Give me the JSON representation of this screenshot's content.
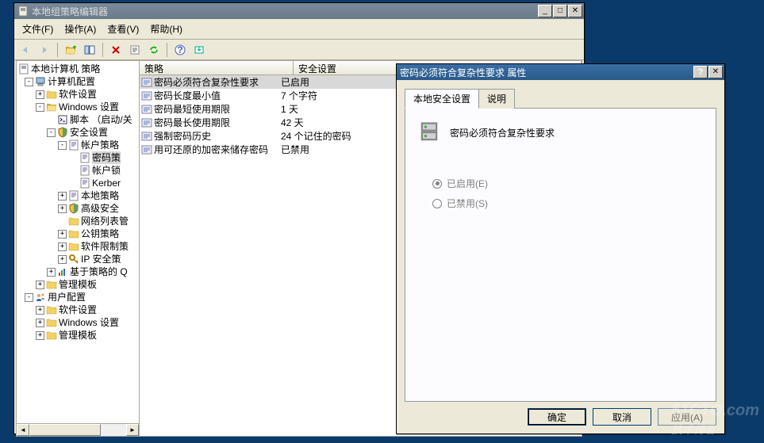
{
  "main_window": {
    "title": "本地组策略编辑器",
    "menu": {
      "file": "文件(F)",
      "action": "操作(A)",
      "view": "查看(V)",
      "help": "帮助(H)"
    }
  },
  "tree": {
    "root": "本地计算机 策略",
    "computer_config": "计算机配置",
    "software_settings": "软件设置",
    "windows_settings": "Windows 设置",
    "scripts": "脚本 （启动/关",
    "security_settings": "安全设置",
    "account_policies": "帐户策略",
    "password_policy": "密码策",
    "account_lockout": "帐户锁",
    "kerberos": "Kerber",
    "local_policies": "本地策略",
    "advanced_security": "高级安全",
    "network_list": "网络列表管",
    "public_key": "公钥策略",
    "software_restrict": "软件限制策",
    "ip_security": "IP 安全策",
    "policy_based_q": "基于策略的 Q",
    "admin_templates": "管理模板",
    "user_config": "用户配置",
    "software_settings2": "软件设置",
    "windows_settings2": "Windows 设置",
    "admin_templates2": "管理模板"
  },
  "list": {
    "col_policy": "策略",
    "col_setting": "安全设置",
    "rows": [
      {
        "name": "密码必须符合复杂性要求",
        "value": "已启用"
      },
      {
        "name": "密码长度最小值",
        "value": "7 个字符"
      },
      {
        "name": "密码最短使用期限",
        "value": "1 天"
      },
      {
        "name": "密码最长使用期限",
        "value": "42 天"
      },
      {
        "name": "强制密码历史",
        "value": "24 个记住的密码"
      },
      {
        "name": "用可还原的加密来储存密码",
        "value": "已禁用"
      }
    ]
  },
  "dialog": {
    "title": "密码必须符合复杂性要求 属性",
    "tab_local": "本地安全设置",
    "tab_explain": "说明",
    "policy_name": "密码必须符合复杂性要求",
    "enabled": "已启用(E)",
    "disabled": "已禁用(S)",
    "ok": "确定",
    "cancel": "取消",
    "apply": "应用(A)"
  },
  "watermark": "51CTO.com\n技术博客"
}
